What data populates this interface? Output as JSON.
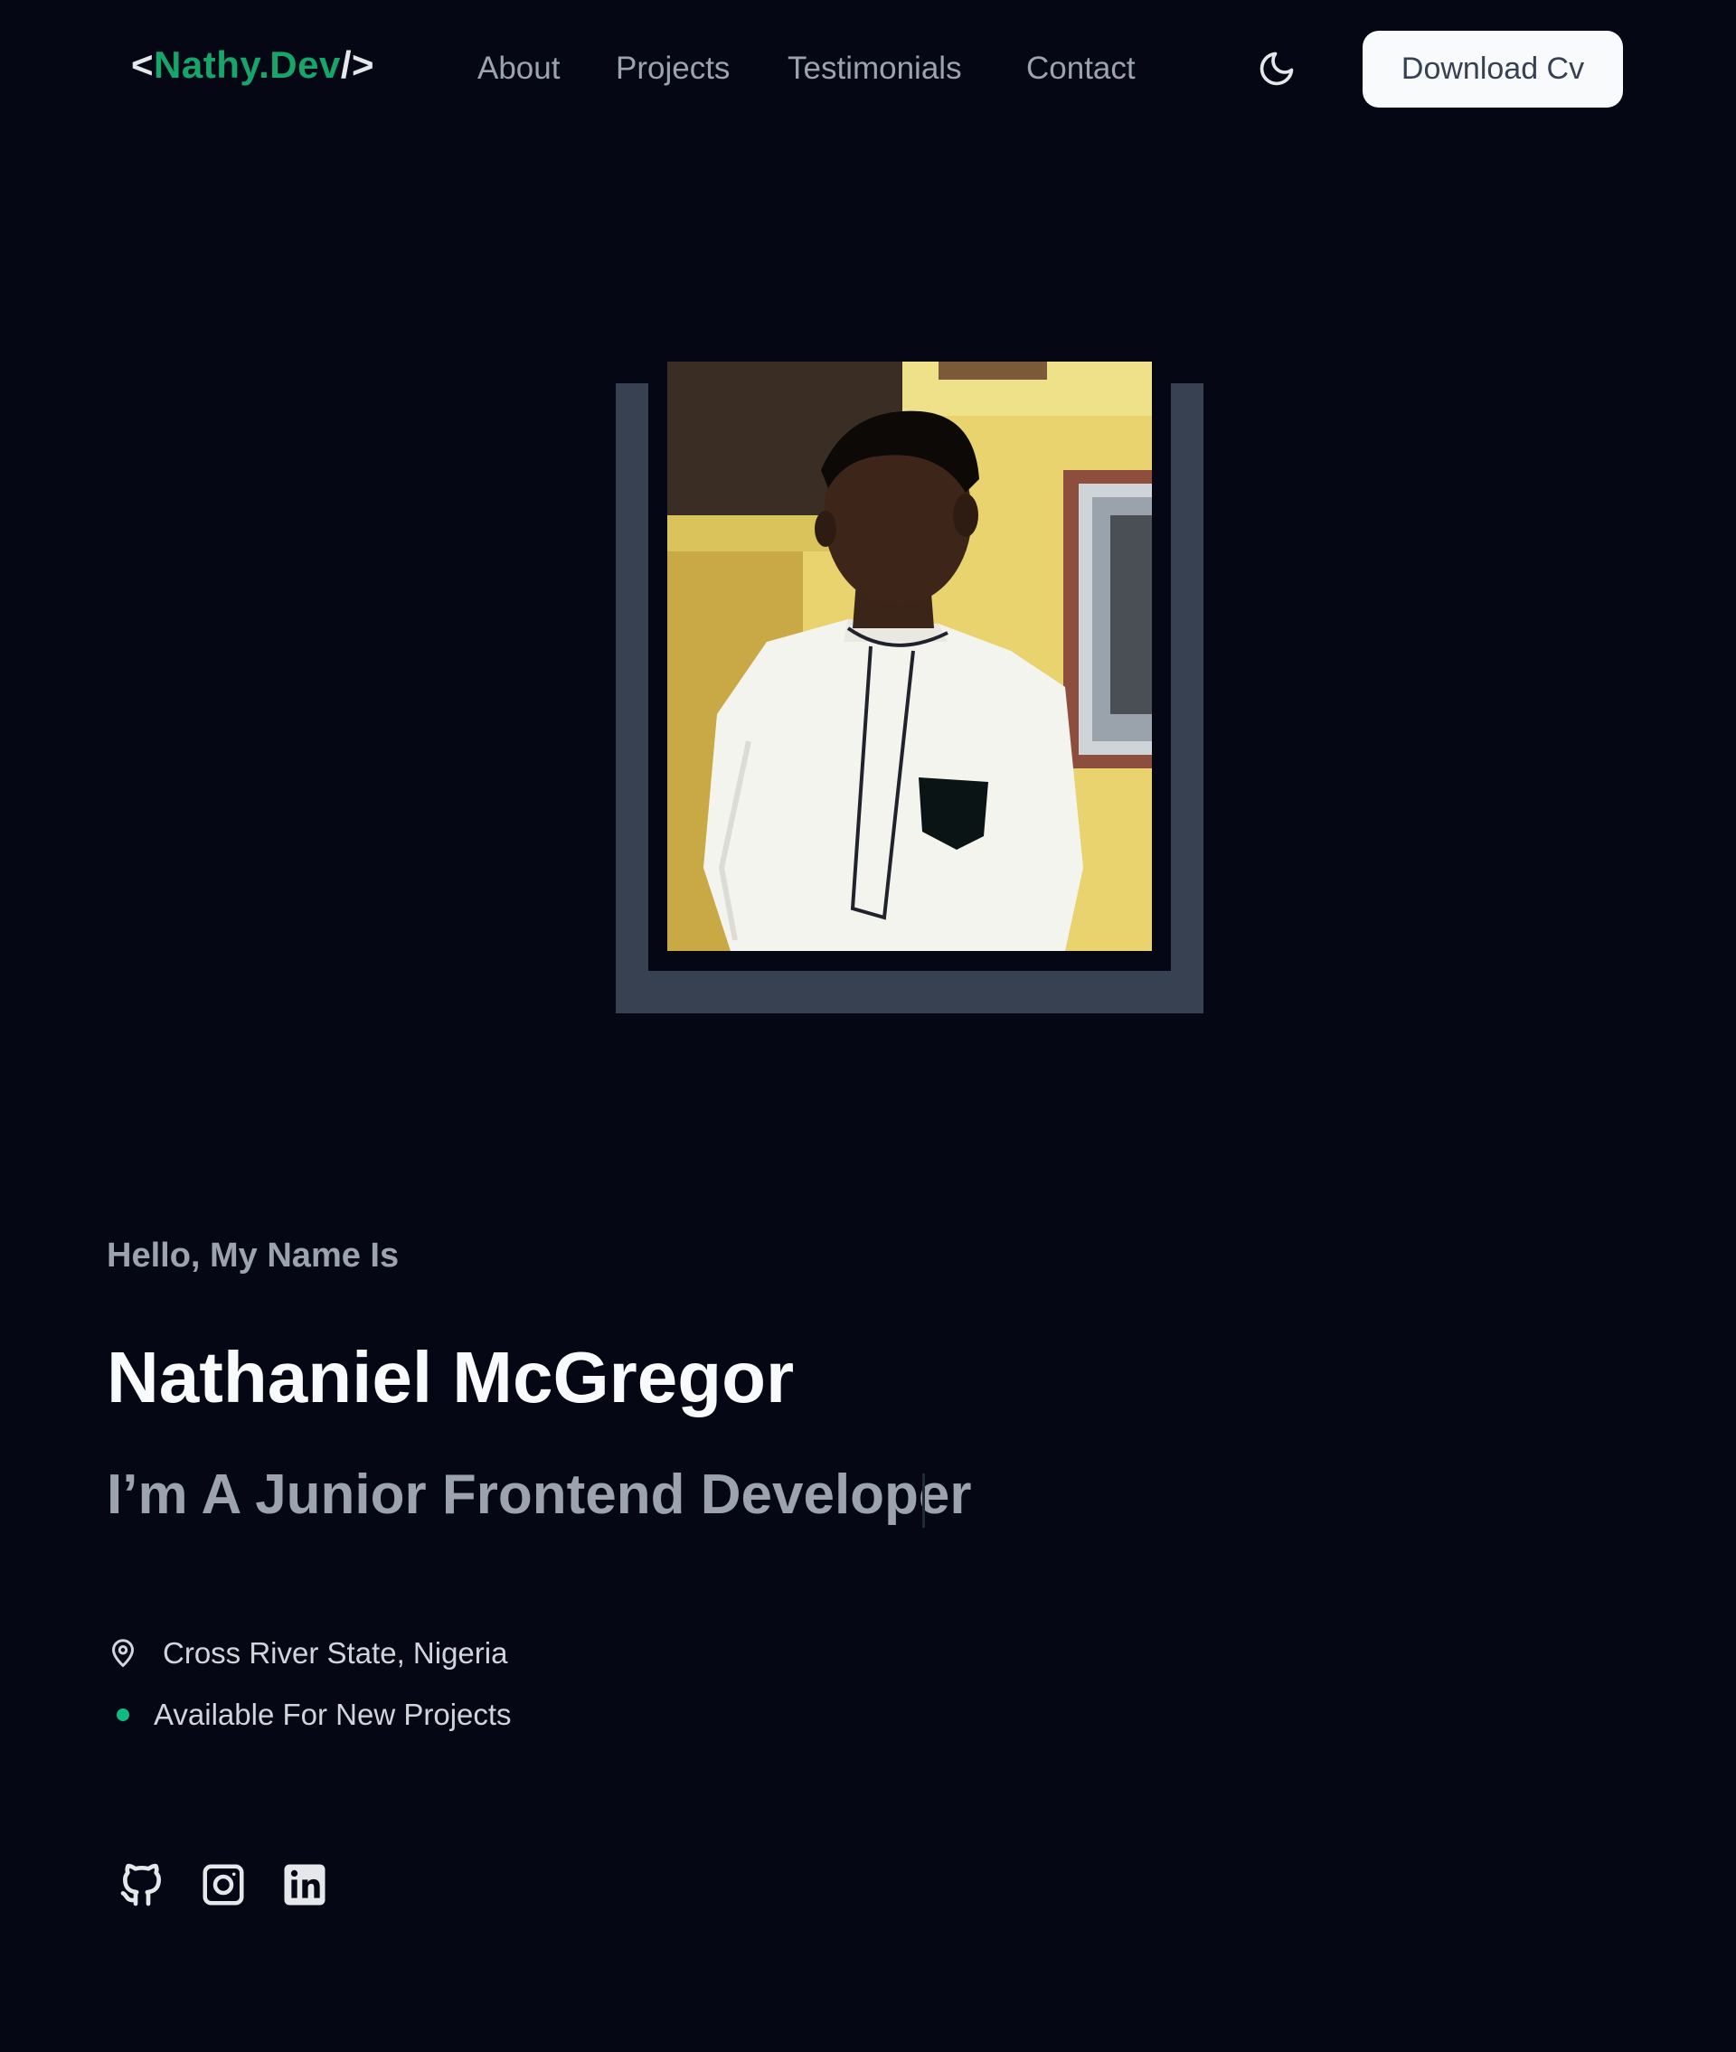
{
  "header": {
    "logo": {
      "open": "<",
      "brand": "Nathy.Dev",
      "close": "/>"
    },
    "nav": [
      {
        "label": "About"
      },
      {
        "label": "Projects"
      },
      {
        "label": "Testimonials"
      },
      {
        "label": "Contact"
      }
    ],
    "theme_toggle_icon": "moon-icon",
    "cv_button_label": "Download Cv"
  },
  "hero": {
    "greeting": "Hello, My Name Is",
    "name": "Nathaniel McGregor",
    "role": "I’m A Junior Frontend Developer",
    "location": "Cross River State, Nigeria",
    "availability": "Available For New Projects",
    "socials": [
      {
        "icon": "github-icon"
      },
      {
        "icon": "instagram-icon"
      },
      {
        "icon": "linkedin-icon"
      }
    ]
  },
  "colors": {
    "background": "#050814",
    "accent_green": "#16a56a",
    "frame": "#374151",
    "muted_text": "#9ca3af"
  }
}
